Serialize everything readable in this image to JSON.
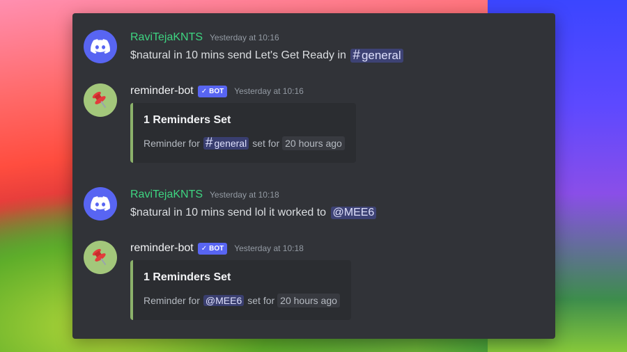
{
  "messages": [
    {
      "username": "RaviTejaKNTS",
      "timestamp": "Yesterday at 10:16",
      "text_before": "$natural in 10 mins send Let's Get Ready in",
      "mention": "general"
    },
    {
      "username": "reminder-bot",
      "bot_tag": "BOT",
      "timestamp": "Yesterday at 10:16",
      "embed": {
        "title": "1 Reminders Set",
        "desc_prefix": "Reminder for",
        "mention": "general",
        "desc_mid": "set for",
        "duration": "20 hours ago"
      }
    },
    {
      "username": "RaviTejaKNTS",
      "timestamp": "Yesterday at 10:18",
      "text_before": "$natural in 10 mins send lol it worked to",
      "mention": "@MEE6"
    },
    {
      "username": "reminder-bot",
      "bot_tag": "BOT",
      "timestamp": "Yesterday at 10:18",
      "embed": {
        "title": "1 Reminders Set",
        "desc_prefix": "Reminder for",
        "mention": "@MEE6",
        "desc_mid": "set for",
        "duration": "20 hours ago"
      }
    }
  ],
  "colors": {
    "panel_bg": "#313338",
    "user_name": "#3ed581",
    "bot_tag": "#5865f2",
    "embed_border": "#8bb16a"
  },
  "icons": {
    "user_avatar": "discord-logo-icon",
    "bot_avatar": "pushpin-icon",
    "bot_check": "checkmark-icon",
    "channel": "hash-icon"
  }
}
